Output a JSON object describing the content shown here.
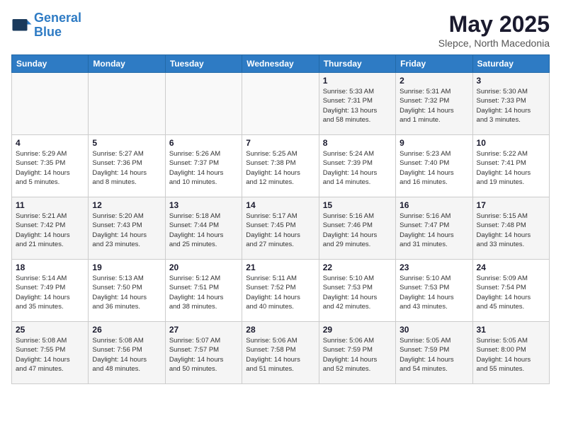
{
  "header": {
    "logo_line1": "General",
    "logo_line2": "Blue",
    "month": "May 2025",
    "location": "Slepce, North Macedonia"
  },
  "weekdays": [
    "Sunday",
    "Monday",
    "Tuesday",
    "Wednesday",
    "Thursday",
    "Friday",
    "Saturday"
  ],
  "weeks": [
    [
      {
        "day": "",
        "info": ""
      },
      {
        "day": "",
        "info": ""
      },
      {
        "day": "",
        "info": ""
      },
      {
        "day": "",
        "info": ""
      },
      {
        "day": "1",
        "info": "Sunrise: 5:33 AM\nSunset: 7:31 PM\nDaylight: 13 hours\nand 58 minutes."
      },
      {
        "day": "2",
        "info": "Sunrise: 5:31 AM\nSunset: 7:32 PM\nDaylight: 14 hours\nand 1 minute."
      },
      {
        "day": "3",
        "info": "Sunrise: 5:30 AM\nSunset: 7:33 PM\nDaylight: 14 hours\nand 3 minutes."
      }
    ],
    [
      {
        "day": "4",
        "info": "Sunrise: 5:29 AM\nSunset: 7:35 PM\nDaylight: 14 hours\nand 5 minutes."
      },
      {
        "day": "5",
        "info": "Sunrise: 5:27 AM\nSunset: 7:36 PM\nDaylight: 14 hours\nand 8 minutes."
      },
      {
        "day": "6",
        "info": "Sunrise: 5:26 AM\nSunset: 7:37 PM\nDaylight: 14 hours\nand 10 minutes."
      },
      {
        "day": "7",
        "info": "Sunrise: 5:25 AM\nSunset: 7:38 PM\nDaylight: 14 hours\nand 12 minutes."
      },
      {
        "day": "8",
        "info": "Sunrise: 5:24 AM\nSunset: 7:39 PM\nDaylight: 14 hours\nand 14 minutes."
      },
      {
        "day": "9",
        "info": "Sunrise: 5:23 AM\nSunset: 7:40 PM\nDaylight: 14 hours\nand 16 minutes."
      },
      {
        "day": "10",
        "info": "Sunrise: 5:22 AM\nSunset: 7:41 PM\nDaylight: 14 hours\nand 19 minutes."
      }
    ],
    [
      {
        "day": "11",
        "info": "Sunrise: 5:21 AM\nSunset: 7:42 PM\nDaylight: 14 hours\nand 21 minutes."
      },
      {
        "day": "12",
        "info": "Sunrise: 5:20 AM\nSunset: 7:43 PM\nDaylight: 14 hours\nand 23 minutes."
      },
      {
        "day": "13",
        "info": "Sunrise: 5:18 AM\nSunset: 7:44 PM\nDaylight: 14 hours\nand 25 minutes."
      },
      {
        "day": "14",
        "info": "Sunrise: 5:17 AM\nSunset: 7:45 PM\nDaylight: 14 hours\nand 27 minutes."
      },
      {
        "day": "15",
        "info": "Sunrise: 5:16 AM\nSunset: 7:46 PM\nDaylight: 14 hours\nand 29 minutes."
      },
      {
        "day": "16",
        "info": "Sunrise: 5:16 AM\nSunset: 7:47 PM\nDaylight: 14 hours\nand 31 minutes."
      },
      {
        "day": "17",
        "info": "Sunrise: 5:15 AM\nSunset: 7:48 PM\nDaylight: 14 hours\nand 33 minutes."
      }
    ],
    [
      {
        "day": "18",
        "info": "Sunrise: 5:14 AM\nSunset: 7:49 PM\nDaylight: 14 hours\nand 35 minutes."
      },
      {
        "day": "19",
        "info": "Sunrise: 5:13 AM\nSunset: 7:50 PM\nDaylight: 14 hours\nand 36 minutes."
      },
      {
        "day": "20",
        "info": "Sunrise: 5:12 AM\nSunset: 7:51 PM\nDaylight: 14 hours\nand 38 minutes."
      },
      {
        "day": "21",
        "info": "Sunrise: 5:11 AM\nSunset: 7:52 PM\nDaylight: 14 hours\nand 40 minutes."
      },
      {
        "day": "22",
        "info": "Sunrise: 5:10 AM\nSunset: 7:53 PM\nDaylight: 14 hours\nand 42 minutes."
      },
      {
        "day": "23",
        "info": "Sunrise: 5:10 AM\nSunset: 7:53 PM\nDaylight: 14 hours\nand 43 minutes."
      },
      {
        "day": "24",
        "info": "Sunrise: 5:09 AM\nSunset: 7:54 PM\nDaylight: 14 hours\nand 45 minutes."
      }
    ],
    [
      {
        "day": "25",
        "info": "Sunrise: 5:08 AM\nSunset: 7:55 PM\nDaylight: 14 hours\nand 47 minutes."
      },
      {
        "day": "26",
        "info": "Sunrise: 5:08 AM\nSunset: 7:56 PM\nDaylight: 14 hours\nand 48 minutes."
      },
      {
        "day": "27",
        "info": "Sunrise: 5:07 AM\nSunset: 7:57 PM\nDaylight: 14 hours\nand 50 minutes."
      },
      {
        "day": "28",
        "info": "Sunrise: 5:06 AM\nSunset: 7:58 PM\nDaylight: 14 hours\nand 51 minutes."
      },
      {
        "day": "29",
        "info": "Sunrise: 5:06 AM\nSunset: 7:59 PM\nDaylight: 14 hours\nand 52 minutes."
      },
      {
        "day": "30",
        "info": "Sunrise: 5:05 AM\nSunset: 7:59 PM\nDaylight: 14 hours\nand 54 minutes."
      },
      {
        "day": "31",
        "info": "Sunrise: 5:05 AM\nSunset: 8:00 PM\nDaylight: 14 hours\nand 55 minutes."
      }
    ]
  ]
}
